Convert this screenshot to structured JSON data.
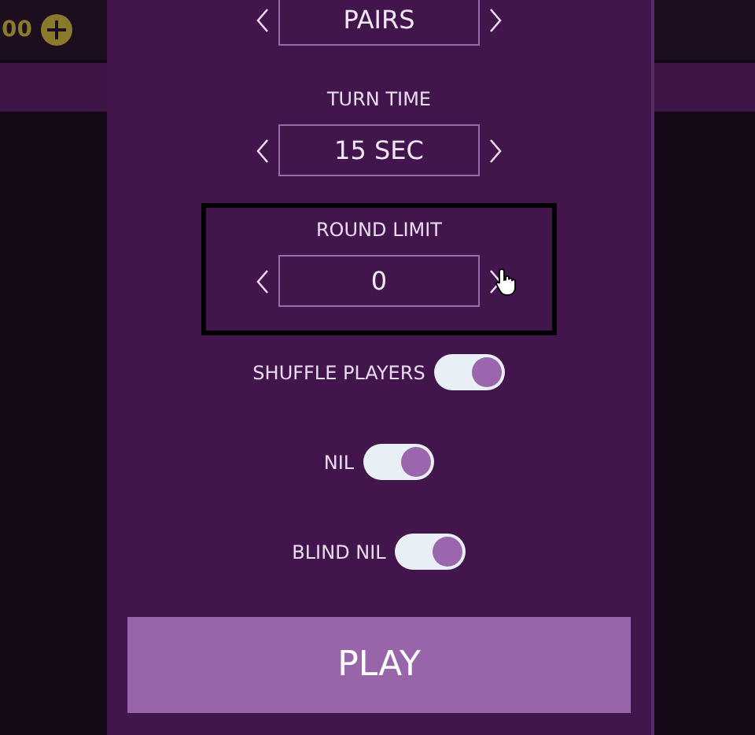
{
  "top_bar": {
    "coins": "00"
  },
  "settings": [
    {
      "kind": "selector",
      "value": "PAIRS",
      "focused": false
    },
    {
      "kind": "selector",
      "label": "TURN TIME",
      "value": "15 SEC",
      "focused": false
    },
    {
      "kind": "selector",
      "label": "ROUND LIMIT",
      "value": "0",
      "focused": true
    },
    {
      "kind": "toggle",
      "label": "SHUFFLE PLAYERS",
      "on": true
    },
    {
      "kind": "toggle",
      "label": "NIL",
      "on": true
    },
    {
      "kind": "toggle",
      "label": "BLIND NIL",
      "on": true
    }
  ],
  "play_button": "PLAY"
}
